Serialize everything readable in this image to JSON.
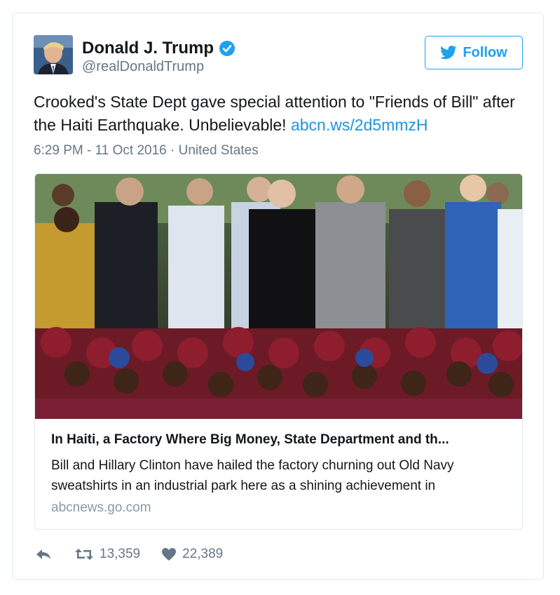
{
  "user": {
    "name": "Donald J. Trump",
    "handle": "@realDonaldTrump"
  },
  "follow_label": "Follow",
  "tweet": {
    "text": "Crooked's State Dept gave special attention to \"Friends of Bill\" after the Haiti Earthquake. Unbelievable!",
    "link": "abcn.ws/2d5mmzH",
    "timestamp": "6:29 PM - 11 Oct 2016",
    "separator": "·",
    "location": "United States"
  },
  "card": {
    "title": "In Haiti, a Factory Where Big Money, State Department and th...",
    "description": "Bill and Hillary Clinton have hailed the factory churning out Old Navy sweatshirts in an industrial park here as a shining achievement in",
    "domain": "abcnews.go.com"
  },
  "actions": {
    "retweets": "13,359",
    "likes": "22,389"
  },
  "colors": {
    "accent": "#1da1f2",
    "link": "#1b95e0",
    "muted": "#657786"
  },
  "icons": [
    "verified-badge-icon",
    "twitter-bird-icon",
    "reply-icon",
    "retweet-icon",
    "heart-icon"
  ]
}
